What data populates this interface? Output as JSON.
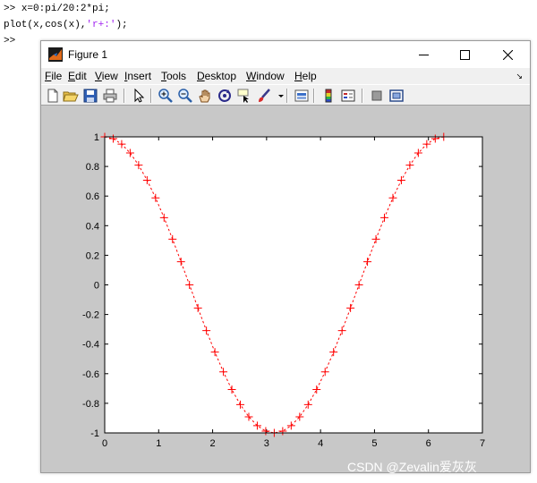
{
  "console": {
    "line1_prompt": ">>",
    "line1_cmd": "x=0:pi/20:2*pi;",
    "line2_pre": "plot(x,cos(x),",
    "line2_str": "'r+:'",
    "line2_post": ");",
    "line3_prompt": ">>"
  },
  "window": {
    "title": "Figure 1",
    "minimize_label": "minimize",
    "maximize_label": "maximize",
    "close_label": "close"
  },
  "menubar": {
    "items": [
      {
        "key": "F",
        "rest": "ile"
      },
      {
        "key": "E",
        "rest": "dit"
      },
      {
        "key": "V",
        "rest": "iew"
      },
      {
        "key": "I",
        "rest": "nsert"
      },
      {
        "key": "T",
        "rest": "ools"
      },
      {
        "key": "D",
        "rest": "esktop"
      },
      {
        "key": "W",
        "rest": "indow"
      },
      {
        "key": "H",
        "rest": "elp"
      }
    ],
    "overflow_arrow": "↘"
  },
  "toolbar": {
    "icons": [
      "new-figure-icon",
      "open-file-icon",
      "save-figure-icon",
      "print-figure-icon",
      "edit-plot-arrow-icon",
      "zoom-in-icon",
      "zoom-out-icon",
      "pan-hand-icon",
      "rotate-3d-icon",
      "data-cursor-icon",
      "brush-icon",
      "brush-dropdown-icon",
      "link-plot-icon",
      "colorbar-icon",
      "legend-icon",
      "hide-plot-tools-icon",
      "show-plot-tools-icon"
    ]
  },
  "colors": {
    "figure_bg": "#c8c8c8",
    "axes_bg": "#ffffff",
    "line": "#ff0000",
    "watermark": "#ffffff"
  },
  "chart_data": {
    "type": "line",
    "function": "cos(x)",
    "x_start": 0,
    "x_step_expr": "pi/20",
    "x_end_expr": "2*pi",
    "num_points": 41,
    "line_style": "dotted",
    "marker": "+",
    "color": "#ff0000",
    "xlim": [
      0,
      7
    ],
    "ylim": [
      -1,
      1
    ],
    "xticks": [
      "0",
      "1",
      "2",
      "3",
      "4",
      "5",
      "6",
      "7"
    ],
    "yticks": [
      "1",
      "0.8",
      "0.6",
      "0.4",
      "0.2",
      "0",
      "-0.2",
      "-0.4",
      "-0.6",
      "-0.8",
      "-1"
    ],
    "grid": false
  },
  "watermark": "CSDN @Zevalin爱灰灰"
}
